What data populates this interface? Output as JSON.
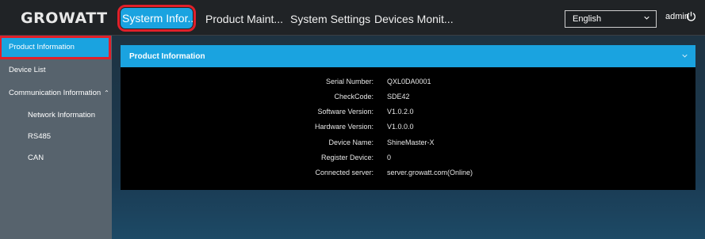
{
  "brand": {
    "logo": "GROWATT"
  },
  "nav": {
    "tabs": [
      {
        "label": "Systerm Infor..."
      },
      {
        "label": "Product Maint..."
      },
      {
        "label": "System Settings"
      },
      {
        "label": "Devices Monit..."
      }
    ]
  },
  "header": {
    "language": "English",
    "user": "admin"
  },
  "sidebar": {
    "items": [
      {
        "label": "Product Information"
      },
      {
        "label": "Device List"
      },
      {
        "label": "Communication Information",
        "expanded": true
      },
      {
        "label": "Network Information"
      },
      {
        "label": "RS485"
      },
      {
        "label": "CAN"
      }
    ]
  },
  "panel": {
    "title": "Product Information",
    "rows": [
      {
        "label": "Serial Number:",
        "value": "QXL0DA0001"
      },
      {
        "label": "CheckCode:",
        "value": "SDE42"
      },
      {
        "label": "Software Version:",
        "value": "V1.0.2.0"
      },
      {
        "label": "Hardware Version:",
        "value": "V1.0.0.0"
      },
      {
        "label": "Device Name:",
        "value": "ShineMaster-X"
      },
      {
        "label": "Register Device:",
        "value": "0"
      },
      {
        "label": "Connected server:",
        "value": "server.growatt.com(Online)"
      }
    ]
  },
  "colors": {
    "accent": "#1aa3e0",
    "highlight_border": "#e0202a",
    "sidebar_bg": "#57636d",
    "topbar_bg": "#202326",
    "panel_bg": "#000000"
  }
}
